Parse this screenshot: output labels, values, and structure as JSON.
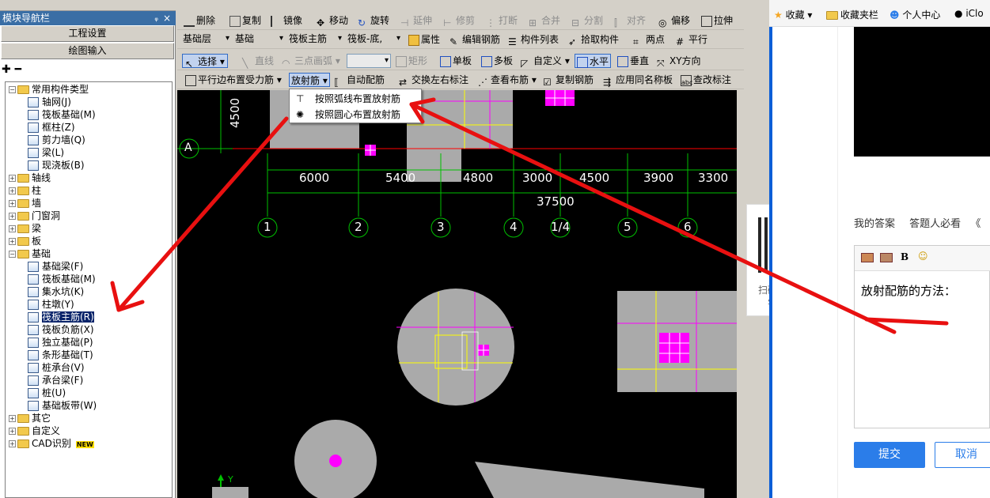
{
  "nav": {
    "title": "模块导航栏",
    "pin": "ᵩ",
    "close": "×",
    "btn_project": "工程设置",
    "btn_draw": "绘图输入",
    "tools": "✚ ━",
    "tree": [
      {
        "label": "常用构件类型",
        "level": 0,
        "exp": "−",
        "type": "folder"
      },
      {
        "label": "轴网(J)",
        "level": 1,
        "type": "comp"
      },
      {
        "label": "筏板基础(M)",
        "level": 1,
        "type": "comp"
      },
      {
        "label": "框柱(Z)",
        "level": 1,
        "type": "comp"
      },
      {
        "label": "剪力墙(Q)",
        "level": 1,
        "type": "comp"
      },
      {
        "label": "梁(L)",
        "level": 1,
        "type": "comp"
      },
      {
        "label": "现浇板(B)",
        "level": 1,
        "type": "comp"
      },
      {
        "label": "轴线",
        "level": 0,
        "exp": "+",
        "type": "folder"
      },
      {
        "label": "柱",
        "level": 0,
        "exp": "+",
        "type": "folder"
      },
      {
        "label": "墙",
        "level": 0,
        "exp": "+",
        "type": "folder"
      },
      {
        "label": "门窗洞",
        "level": 0,
        "exp": "+",
        "type": "folder"
      },
      {
        "label": "梁",
        "level": 0,
        "exp": "+",
        "type": "folder"
      },
      {
        "label": "板",
        "level": 0,
        "exp": "+",
        "type": "folder"
      },
      {
        "label": "基础",
        "level": 0,
        "exp": "−",
        "type": "folder"
      },
      {
        "label": "基础梁(F)",
        "level": 1,
        "type": "comp"
      },
      {
        "label": "筏板基础(M)",
        "level": 1,
        "type": "comp"
      },
      {
        "label": "集水坑(K)",
        "level": 1,
        "type": "comp"
      },
      {
        "label": "柱墩(Y)",
        "level": 1,
        "type": "comp"
      },
      {
        "label": "筏板主筋(R)",
        "level": 1,
        "type": "comp",
        "selected": true
      },
      {
        "label": "筏板负筋(X)",
        "level": 1,
        "type": "comp"
      },
      {
        "label": "独立基础(P)",
        "level": 1,
        "type": "comp"
      },
      {
        "label": "条形基础(T)",
        "level": 1,
        "type": "comp"
      },
      {
        "label": "桩承台(V)",
        "level": 1,
        "type": "comp"
      },
      {
        "label": "承台梁(F)",
        "level": 1,
        "type": "comp"
      },
      {
        "label": "桩(U)",
        "level": 1,
        "type": "comp"
      },
      {
        "label": "基础板带(W)",
        "level": 1,
        "type": "comp"
      },
      {
        "label": "其它",
        "level": 0,
        "exp": "+",
        "type": "folder"
      },
      {
        "label": "自定义",
        "level": 0,
        "exp": "+",
        "type": "folder"
      },
      {
        "label": "CAD识别",
        "level": 0,
        "exp": "+",
        "type": "folder",
        "badge": "NEW"
      }
    ]
  },
  "toolbar": {
    "row0": {
      "delete": "删除",
      "copy": "复制",
      "mirror": "镜像",
      "move": "移动",
      "rotate": "旋转",
      "extend": "延伸",
      "trim": "修剪",
      "break": "打断",
      "merge": "合并",
      "split": "分割",
      "align": "对齐",
      "offset": "偏移",
      "stretch": "拉伸"
    },
    "row1": {
      "layer": "基础层",
      "category": "基础",
      "component_type": "筏板主筋",
      "component": "筏板-底,",
      "props": "属性",
      "edit_rebar": "编辑钢筋",
      "comp_list": "构件列表",
      "pick": "拾取构件",
      "two_points": "两点",
      "parallel": "平行"
    },
    "row2": {
      "select": "选择",
      "line": "直线",
      "arc": "三点画弧",
      "rect": "矩形",
      "single": "单板",
      "multi": "多板",
      "custom": "自定义",
      "horizontal": "水平",
      "vertical": "垂直",
      "xy": "XY方向"
    },
    "row3": {
      "parallel_edge": "平行边布置受力筋",
      "radial": "放射筋",
      "auto": "自动配筋",
      "swap": "交换左右标注",
      "view": "查看布筋",
      "copy_rebar": "复制钢筋",
      "apply_same": "应用同名称板",
      "check": "查改标注"
    }
  },
  "dropdown": {
    "item1": "按照弧线布置放射筋",
    "item2": "按照圆心布置放射筋"
  },
  "canvas": {
    "dims_top": [
      "6000",
      "5400",
      "4800",
      "3000",
      "4500",
      "3900",
      "3300"
    ],
    "total": "37500",
    "left_dim": "4500",
    "axis_letter": "A",
    "axis_numbers": [
      "1",
      "2",
      "3",
      "4",
      "1/4",
      "5",
      "6"
    ],
    "y_label": "Y"
  },
  "qr": {
    "close": "×",
    "caption": "扫码领取免费学习视频"
  },
  "browser": {
    "bookmarks": [
      "收藏",
      "收藏夹栏",
      "个人中心",
      "iClo"
    ],
    "tabs": [
      "我的答案",
      "答题人必看",
      "《"
    ],
    "editor_text": "放射配筋的方法：",
    "bold": "B",
    "submit": "提交",
    "cancel": "取消"
  },
  "colors": {
    "grid": "#00c000",
    "magenta": "#ff00ff",
    "yellow": "#ffff00",
    "gray": "#aaaaaa",
    "red": "#ff0000",
    "arrow": "#e81010"
  }
}
